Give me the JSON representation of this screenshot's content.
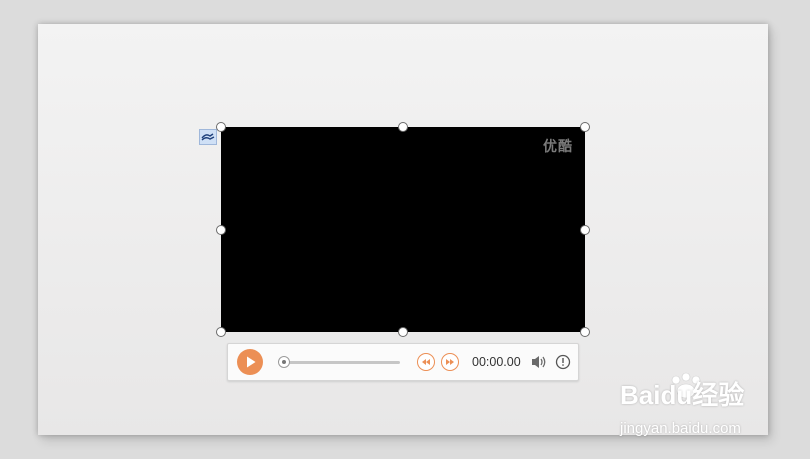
{
  "video": {
    "watermark": "优酷"
  },
  "player": {
    "time": "00:00.00",
    "progress": 0
  },
  "watermark_site": {
    "logo_text": "Baidu经验",
    "url": "jingyan.baidu.com"
  },
  "colors": {
    "accent": "#ec8f55",
    "video_bg": "#000000"
  },
  "icons": [
    "play-icon",
    "rewind-icon",
    "fast-forward-icon",
    "volume-icon",
    "info-icon",
    "media-tag-icon"
  ]
}
